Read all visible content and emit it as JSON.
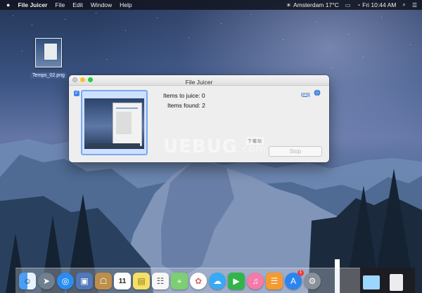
{
  "menubar": {
    "apple_icon": "apple-logo-icon",
    "app_name": "File Juicer",
    "items": [
      "File",
      "Edit",
      "Window",
      "Help"
    ],
    "status": {
      "weather": "Amsterdam 17°C",
      "clock": "Fri 10:44 AM"
    }
  },
  "desktop": {
    "file_label": "Temps_02.png"
  },
  "window": {
    "title": "File Juicer",
    "items_to_juice_label": "Items to juice:",
    "items_to_juice_value": "0",
    "items_found_label": "Items found:",
    "items_found_value": "2",
    "format_link": "png",
    "stop_button": "Stop"
  },
  "watermark": {
    "text": "UEBUG",
    "domain": ".com",
    "chinese": "下载站"
  },
  "dock": {
    "calendar_day": "11",
    "app_store_badge": "1",
    "apps": [
      "Finder",
      "Launchpad",
      "Safari",
      "Preview",
      "Contacts",
      "Calendar",
      "Notes",
      "Reminders",
      "Maps",
      "Photos",
      "Messages",
      "FaceTime",
      "iTunes",
      "iBooks",
      "App Store",
      "System Preferences"
    ]
  },
  "colors": {
    "selection_blue": "#3f86ed",
    "link_blue": "#2c69c8",
    "menubar_bg": "#12161f"
  }
}
